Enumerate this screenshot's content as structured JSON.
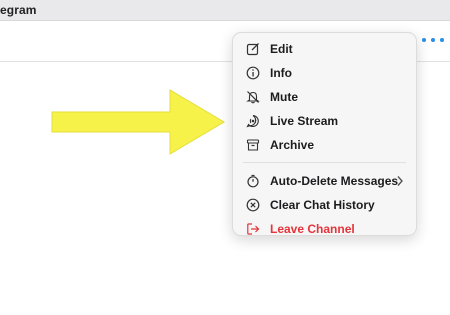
{
  "window": {
    "title": "egram"
  },
  "menu": {
    "group1": [
      {
        "label": "Edit",
        "icon": "edit-icon"
      },
      {
        "label": "Info",
        "icon": "info-icon"
      },
      {
        "label": "Mute",
        "icon": "mute-bell-icon"
      },
      {
        "label": "Live Stream",
        "icon": "live-stream-icon"
      },
      {
        "label": "Archive",
        "icon": "archive-icon"
      }
    ],
    "group2": [
      {
        "label": "Auto-Delete Messages",
        "icon": "timer-icon",
        "submenu": true
      },
      {
        "label": "Clear Chat History",
        "icon": "clear-circle-x-icon"
      },
      {
        "label": "Leave Channel",
        "icon": "leave-icon",
        "danger": true
      }
    ]
  },
  "colors": {
    "accent": "#2a8ee6",
    "danger": "#e5343b",
    "arrow": "#f6f24a"
  }
}
